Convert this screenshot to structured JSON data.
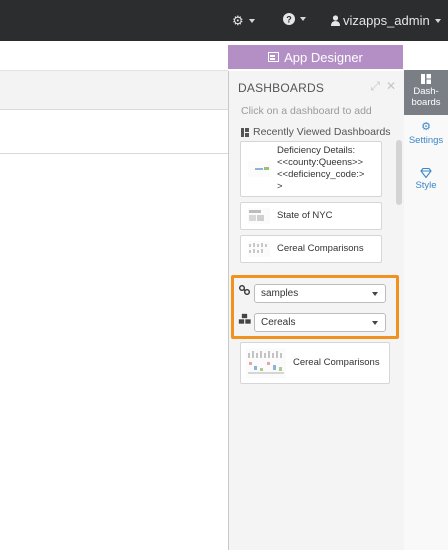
{
  "topbar": {
    "settings_icon": "gear-icon",
    "help_icon": "question-circle-icon",
    "user_icon": "user-icon",
    "username": "vizapps_admin"
  },
  "app_designer": {
    "label": "App Designer",
    "color": "#b48fc6"
  },
  "dashboards_panel": {
    "title": "DASHBOARDS",
    "hint": "Click on a dashboard to add",
    "recent_heading": "Recently Viewed Dashboards",
    "recent": [
      {
        "lines": [
          "Deficiency Details:",
          "<<county:Queens>>",
          "<<deficiency_code:>",
          ">"
        ]
      },
      {
        "lines": [
          "State of NYC"
        ]
      },
      {
        "lines": [
          "Cereal Comparisons"
        ]
      }
    ],
    "connection_select": {
      "value": "samples"
    },
    "dataset_select": {
      "value": "Cereals"
    },
    "result": {
      "label": "Cereal Comparisons"
    },
    "highlight_color": "#f2921e"
  },
  "side_tabs": [
    {
      "label_line1": "Dash-",
      "label_line2": "boards"
    },
    {
      "label": "Settings"
    },
    {
      "label": "Style"
    }
  ]
}
